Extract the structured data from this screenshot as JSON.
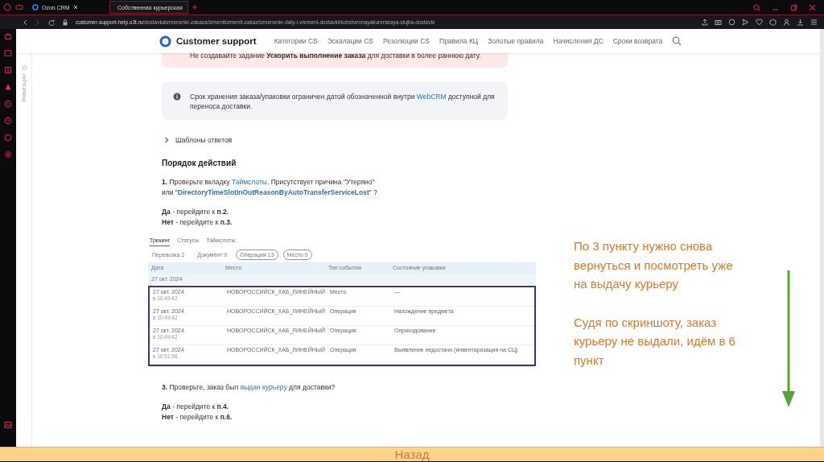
{
  "browser": {
    "tabs": [
      {
        "title": "Ozon.CRM",
        "selected": false
      },
      {
        "title": "Собственная курьерская",
        "selected": true
      }
    ],
    "url_host": "customer-support-help.o3t.ru",
    "url_path": "/dostavkaizmenenie-zakaza/izmenitotmenit-zakaz/izmenenie-daty-i-vremeni-dostavki/sobstvennayakurerskaya-slujba-dostavki"
  },
  "navigation_strip": {
    "label": "Навигация"
  },
  "site": {
    "logo": "Customer support",
    "nav": [
      "Категории CS",
      "Эскалации CS",
      "Резолюции CS",
      "Правила КЦ",
      "Золотые правила",
      "Начисления ДС",
      "Сроки возврата"
    ]
  },
  "warning": "Не создавайте задание **Ускорить выполнение заказа** для доставки в более раннюю дату.",
  "info": [
    {
      "kind": "text",
      "text": "Срок хранения заказа/упаковки ограничен датой обозначенной внутри "
    },
    {
      "kind": "link",
      "text": "WebCRM"
    },
    {
      "kind": "text",
      "text": " доступной для переноса доставки."
    }
  ],
  "templates": {
    "label": "Шаблоны ответов",
    "expanded": false
  },
  "heading": "Порядок действий",
  "step1": [
    [
      {
        "kind": "bold",
        "text": "1."
      },
      {
        "kind": "text",
        "text": " Проверьте вкладку "
      },
      {
        "kind": "link",
        "text": "Таймслоты"
      },
      {
        "kind": "text",
        "text": ". Присутствует причина \"Утеряно\""
      }
    ],
    [
      {
        "kind": "text",
        "text": "или \""
      },
      {
        "kind": "boldlink",
        "text": "DirectoryTimeSlotInOutReasonByAutoTransferServiceLost"
      },
      {
        "kind": "text",
        "text": "\" ?"
      }
    ]
  ],
  "step1_answers": [
    "**Да** - перейдите к **п.2.**",
    "**Нет** - перейдите к **п.3.**"
  ],
  "tracking": {
    "tabs": [
      {
        "label": "Трекинг",
        "selected": true
      },
      {
        "label": "Статусы",
        "selected": false
      },
      {
        "label": "Таймслоты",
        "selected": false
      }
    ],
    "filters": [
      {
        "label": "Перевозка",
        "count": "2",
        "selected": false
      },
      {
        "label": "Документ",
        "count": "0",
        "selected": false
      },
      {
        "label": "Операция",
        "count": "13",
        "selected": true
      },
      {
        "label": "Место",
        "count": "0",
        "selected": true
      }
    ],
    "columns": [
      "Дата",
      "Место",
      "Тип события",
      "Состояние упаковки"
    ],
    "group_date": "27 окт. 2024",
    "highlighted": true,
    "rows": [
      {
        "date": "27 окт. 2024",
        "time": "в 10:49:42",
        "place": "НОВОРОССИЙСК_ХАБ_ЛИНЕЙНЫЙ",
        "event": "Место",
        "state": "—"
      },
      {
        "date": "27 окт. 2024",
        "time": "в 10:49:42",
        "place": "НОВОРОССИЙСК_ХАБ_ЛИНЕЙНЫЙ",
        "event": "Операция",
        "state": "Нахождение предмета"
      },
      {
        "date": "27 окт. 2024",
        "time": "в 10:49:42",
        "place": "НОВОРОССИЙСК_ХАБ_ЛИНЕЙНЫЙ",
        "event": "Операция",
        "state": "Оприходование"
      },
      {
        "date": "27 окт. 2024",
        "time": "в 10:51:56",
        "place": "НОВОРОССИЙСК_ХАБ_ЛИНЕЙНЫЙ",
        "event": "Операция",
        "state": "Выявление недостачи (инвентаризация на СЦ)"
      }
    ]
  },
  "step3": [
    [
      {
        "kind": "bold",
        "text": "3."
      },
      {
        "kind": "text",
        "text": " Проверьте, заказ был "
      },
      {
        "kind": "link",
        "text": "выдан курьеру"
      },
      {
        "kind": "text",
        "text": " для доставки?"
      }
    ]
  ],
  "step3_answers": [
    "**Да** - перейдите к **п.4.**",
    "**Нет** - перейдите к **п.6.**"
  ],
  "annotation": [
    "По 3 пункту нужно снова вернуться и посмотреть уже на выдачу курьеру",
    "Судя по скриншоту, заказ курьеру не выдали, идём в 6 пункт"
  ],
  "back_button": "Назад"
}
